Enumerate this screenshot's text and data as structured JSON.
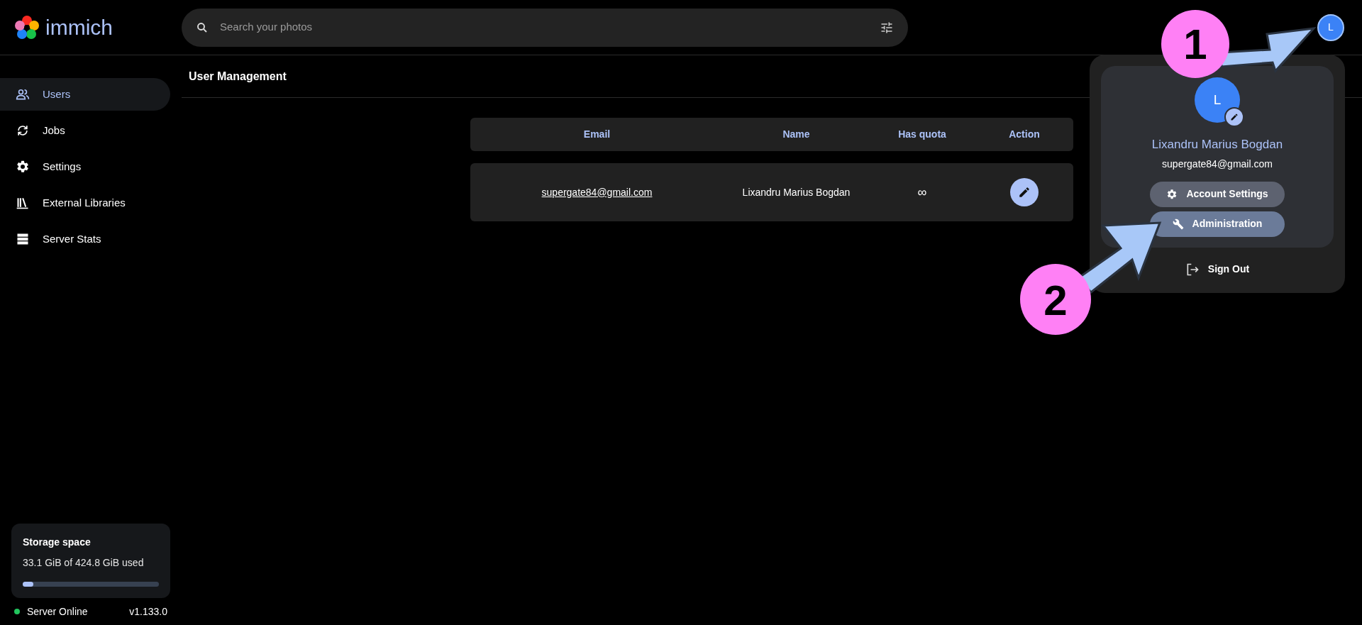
{
  "header": {
    "logo_text": "immich",
    "search": {
      "placeholder": "Search your photos"
    },
    "avatar_initial": "L"
  },
  "sidebar": {
    "items": [
      {
        "label": "Users",
        "kind": "users",
        "selected": true
      },
      {
        "label": "Jobs",
        "kind": "jobs",
        "selected": false
      },
      {
        "label": "Settings",
        "kind": "settings",
        "selected": false
      },
      {
        "label": "External Libraries",
        "kind": "libraries",
        "selected": false
      },
      {
        "label": "Server Stats",
        "kind": "stats",
        "selected": false
      }
    ],
    "storage": {
      "title": "Storage space",
      "usage": "33.1 GiB of 424.8 GiB used",
      "level": 0.078
    },
    "server_status": {
      "label": "Server Online",
      "online": true,
      "version": "v1.133.0"
    }
  },
  "page": {
    "title": "User Management",
    "table": {
      "columns": [
        "Email",
        "Name",
        "Has quota",
        "Action"
      ],
      "rows": [
        {
          "email": "supergate84@gmail.com",
          "name": "Lixandru Marius Bogdan",
          "has_quota": "∞"
        }
      ]
    }
  },
  "account_menu": {
    "avatar_initial": "L",
    "name": "Lixandru Marius Bogdan",
    "email": "supergate84@gmail.com",
    "buttons": [
      {
        "label": "Account Settings",
        "kind": "settings",
        "selected": false
      },
      {
        "label": "Administration",
        "kind": "admin",
        "selected": true
      }
    ],
    "sign_out": "Sign Out"
  },
  "annotations": [
    {
      "label": "1"
    },
    {
      "label": "2"
    }
  ]
}
